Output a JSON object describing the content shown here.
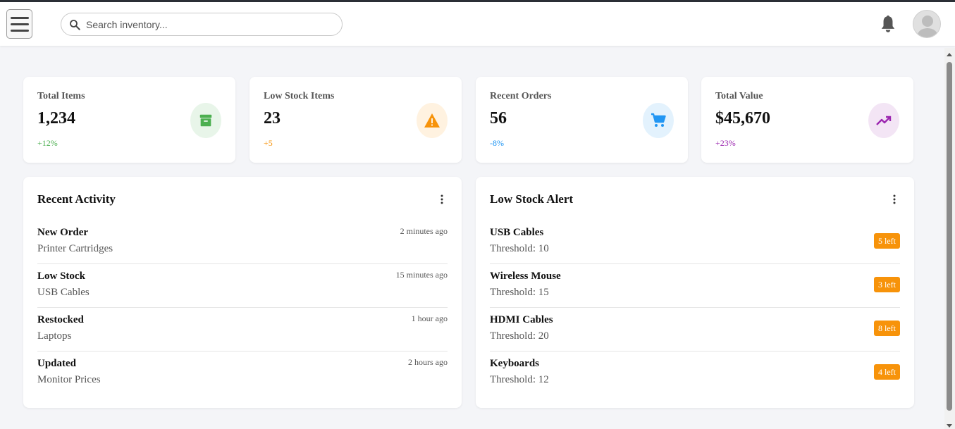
{
  "header": {
    "search_placeholder": "Search inventory..."
  },
  "stats": [
    {
      "label": "Total Items",
      "value": "1,234",
      "change": "+12%",
      "color": "#4caf50",
      "bg": "#e8f5e9",
      "icon": "archive-icon"
    },
    {
      "label": "Low Stock Items",
      "value": "23",
      "change": "+5",
      "color": "#f7930a",
      "bg": "#fff2e0",
      "icon": "warning-icon"
    },
    {
      "label": "Recent Orders",
      "value": "56",
      "change": "-8%",
      "color": "#2196f3",
      "bg": "#e3f2fd",
      "icon": "cart-icon"
    },
    {
      "label": "Total Value",
      "value": "$45,670",
      "change": "+23%",
      "color": "#9c27b0",
      "bg": "#f3e5f5",
      "icon": "trending-up-icon"
    }
  ],
  "recent_activity": {
    "title": "Recent Activity",
    "items": [
      {
        "name": "New Order",
        "detail": "Printer Cartridges",
        "time": "2 minutes ago"
      },
      {
        "name": "Low Stock",
        "detail": "USB Cables",
        "time": "15 minutes ago"
      },
      {
        "name": "Restocked",
        "detail": "Laptops",
        "time": "1 hour ago"
      },
      {
        "name": "Updated",
        "detail": "Monitor Prices",
        "time": "2 hours ago"
      }
    ]
  },
  "low_stock": {
    "title": "Low Stock Alert",
    "badge_color": "#f7930a",
    "items": [
      {
        "name": "USB Cables",
        "threshold": "Threshold: 10",
        "badge": "5 left"
      },
      {
        "name": "Wireless Mouse",
        "threshold": "Threshold: 15",
        "badge": "3 left"
      },
      {
        "name": "HDMI Cables",
        "threshold": "Threshold: 20",
        "badge": "8 left"
      },
      {
        "name": "Keyboards",
        "threshold": "Threshold: 12",
        "badge": "4 left"
      }
    ]
  }
}
